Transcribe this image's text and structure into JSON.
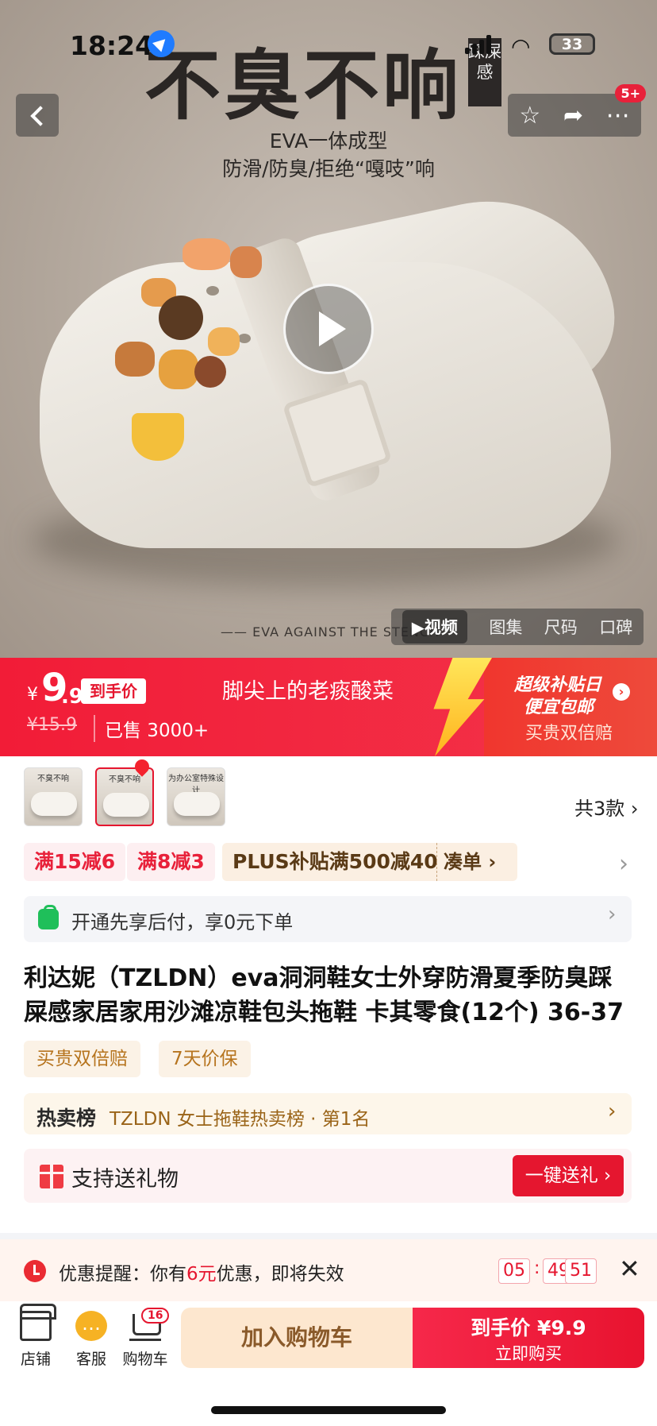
{
  "status_bar": {
    "time": "18:24",
    "battery": "33"
  },
  "hero": {
    "headline": "不臭不响",
    "side_tag": "踩屎感",
    "sub1": "EVA一体成型",
    "sub2": "防滑/防臭/拒绝“嘎吱”响",
    "caption": "—— EVA AGAINST THE STENCH",
    "actions_badge": "5+",
    "media_tabs": [
      "▶视频",
      "图集",
      "尺码",
      "口碑"
    ]
  },
  "price_bar": {
    "yen": "¥",
    "price_int": "9",
    "price_dec": ".9",
    "final_tag": "到手价",
    "original_price": "¥15.9",
    "sold": "已售 3000+",
    "slogan": "脚尖上的老痰酸菜",
    "promo_line1": "超级补贴日",
    "promo_line2": "便宜包邮",
    "promo_line3": "买贵双倍赔"
  },
  "thumbs": {
    "labels": [
      "不臭不响",
      "不臭不响",
      "为办公室特殊设计"
    ],
    "total": "共3款"
  },
  "coupons": [
    "满15减6",
    "满8减3",
    "PLUS补贴满500减40",
    "凑单 ›"
  ],
  "pay_later": "开通先享后付，享0元下单",
  "product_title": "利达妮（TZLDN）eva洞洞鞋女士外穿防滑夏季防臭踩屎感家居家用沙滩凉鞋包头拖鞋 卡其零食(12个) 36-37 ⌵",
  "services": [
    "买贵双倍赔",
    "7天价保"
  ],
  "rank": {
    "head": "热卖榜",
    "text": "TZLDN 女士拖鞋热卖榜 · 第1名"
  },
  "gift": {
    "text": "支持送礼物",
    "button": "一键送礼 ›"
  },
  "reminder": {
    "prefix": "优惠提醒：你有",
    "amount": "6元",
    "suffix": "优惠，即将失效",
    "hh": "05",
    "mm": "49",
    "ss": "51"
  },
  "bottom_bar": {
    "store": "店铺",
    "service": "客服",
    "cart": "购物车",
    "cart_count": "16",
    "add_cart": "加入购物车",
    "buy_line1": "到手价 ¥9.9",
    "buy_line2": "立即购买"
  },
  "colors": {
    "accent": "#e5162f",
    "gold": "#9a6418"
  }
}
